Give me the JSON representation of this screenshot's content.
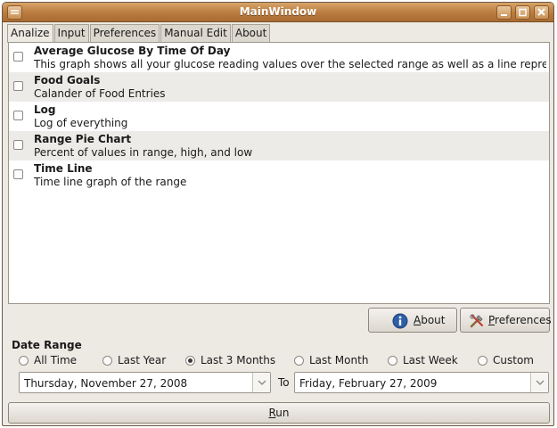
{
  "window": {
    "title": "MainWindow"
  },
  "tabs": [
    {
      "label": "Analize",
      "active": true
    },
    {
      "label": "Input"
    },
    {
      "label": "Preferences"
    },
    {
      "label": "Manual Edit"
    },
    {
      "label": "About"
    }
  ],
  "reports": [
    {
      "title": "Average Glucose By Time Of Day",
      "description": "This graph shows all your glucose reading values over the selected range as well as a line representing ...",
      "checked": false
    },
    {
      "title": "Food Goals",
      "description": "Calander of Food Entries",
      "checked": false
    },
    {
      "title": "Log",
      "description": "Log of everything",
      "checked": false
    },
    {
      "title": "Range Pie Chart",
      "description": "Percent of values in range, high, and low",
      "checked": false
    },
    {
      "title": "Time Line",
      "description": "Time line graph of the range",
      "checked": false
    }
  ],
  "buttons": {
    "about_label_ul": "A",
    "about_label_rest": "bout",
    "about_icon": "info-icon",
    "prefs_label_ul": "P",
    "prefs_label_rest": "references",
    "prefs_icon": "tools-icon",
    "run_label_ul": "R",
    "run_label_rest": "un"
  },
  "date_range": {
    "label": "Date Range",
    "options": [
      "All Time",
      "Last Year",
      "Last 3 Months",
      "Last Month",
      "Last Week",
      "Custom"
    ],
    "selected": "Last 3 Months",
    "from_value": "Thursday, November 27, 2008",
    "to_label": "To",
    "to_value": "Friday, February 27, 2009"
  },
  "colors": {
    "titlebar": "#b97b3e",
    "window_bg": "#ede9e3",
    "info_icon": "#2f5fa8"
  }
}
